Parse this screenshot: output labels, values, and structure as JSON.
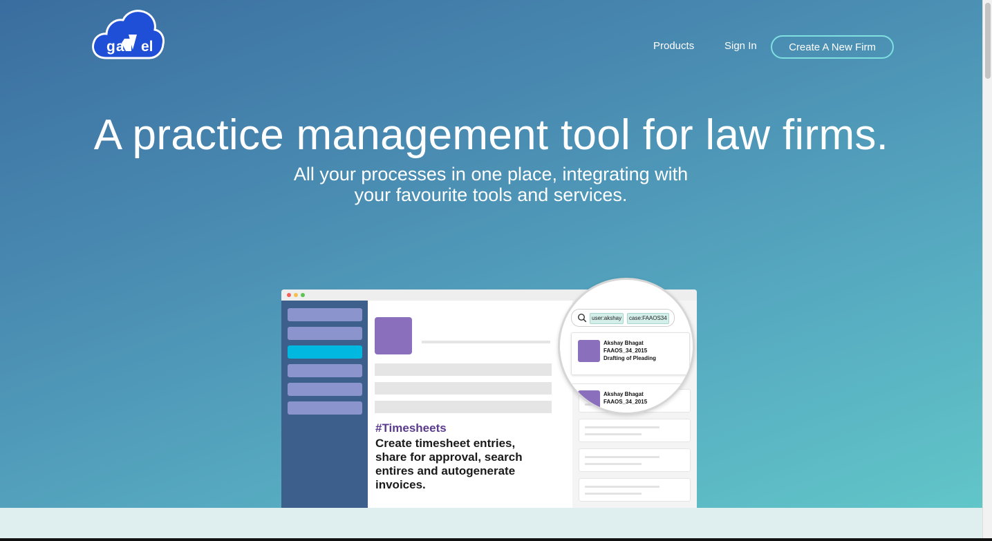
{
  "brand": {
    "name": "gavel",
    "logo_text": "gavel"
  },
  "nav": {
    "products": "Products",
    "sign_in": "Sign In",
    "cta": "Create A New Firm"
  },
  "hero": {
    "title": "A practice management tool for law firms.",
    "subtitle_line1": "All your processes in one place, integrating with",
    "subtitle_line2": "your favourite tools and services."
  },
  "mockup": {
    "feature_tag": "#Timesheets",
    "feature_text": "Create timesheet entries, share for approval, search entires and autogenerate invoices.",
    "search": {
      "tags": [
        "user:akshay",
        "case:FAAOS34"
      ]
    },
    "results": [
      {
        "name": "Akshay Bhagat",
        "case": "FAAOS_34_2015",
        "task": "Drafting of Pleading"
      },
      {
        "name": "Akshay Bhagat",
        "case": "FAAOS_34_2015"
      }
    ]
  },
  "colors": {
    "accent": "#00b8e0",
    "sidebar": "#3d5f8c",
    "menu_item": "#8b94cc",
    "avatar": "#8a6fbd",
    "feature_tag": "#5b3b8c",
    "cta_border": "#7fe0e0"
  },
  "icons": [
    "search-icon"
  ]
}
